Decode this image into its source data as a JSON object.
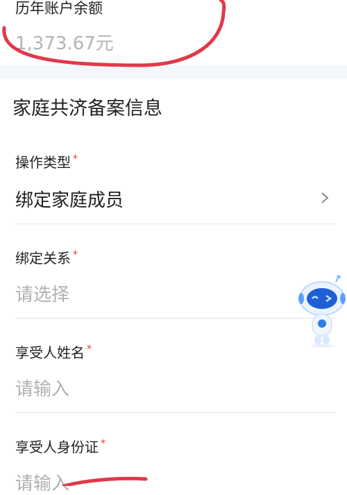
{
  "balance": {
    "label": "历年账户余额",
    "value": "1,373.67元"
  },
  "section_title": "家庭共济备案信息",
  "fields": [
    {
      "label": "操作类型",
      "required_mark": "*",
      "value": "绑定家庭成员"
    },
    {
      "label": "绑定关系",
      "required_mark": "*",
      "value": "请选择"
    },
    {
      "label": "享受人姓名",
      "required_mark": "*",
      "value": "请输入"
    },
    {
      "label": "享受人身份证",
      "required_mark": "*",
      "value": "请输入"
    }
  ],
  "icons": {
    "chevron": "chevron-right-icon",
    "assistant": "robot-assistant-icon"
  },
  "colors": {
    "required": "#e53935",
    "placeholder": "#b0b0b0",
    "annotation": "#e0394a"
  }
}
